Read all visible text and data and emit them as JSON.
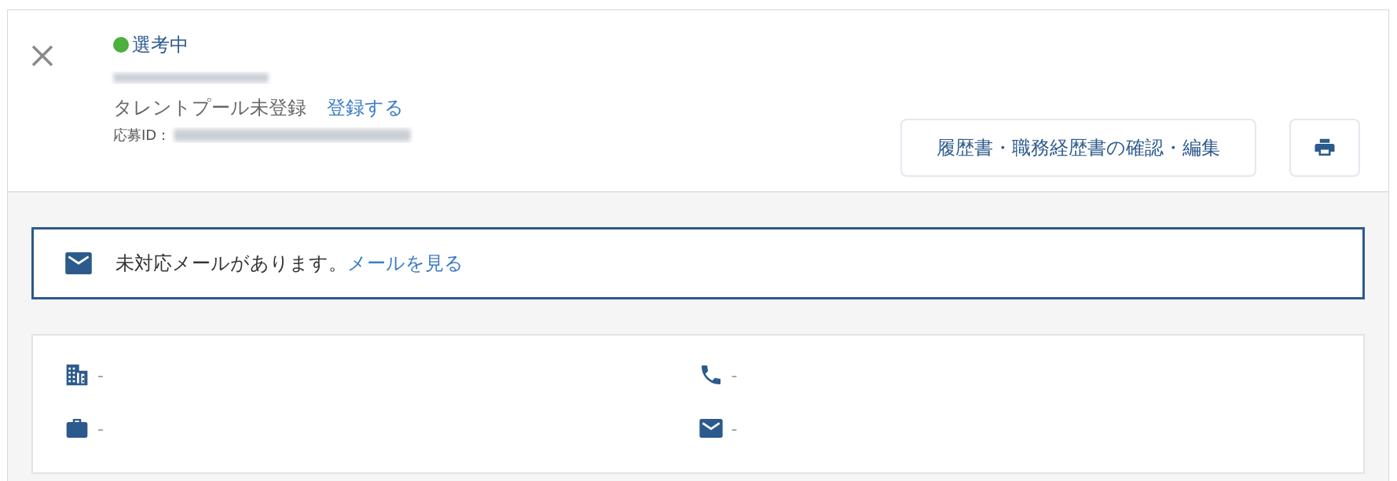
{
  "status": {
    "label": "選考中",
    "color": "#4caf3e"
  },
  "talent_pool": {
    "label": "タレントプール未登録",
    "link": "登録する"
  },
  "application_id": {
    "label": "応募ID："
  },
  "resume_button": {
    "label": "履歴書・職務経歴書の確認・編集"
  },
  "notice": {
    "text": "未対応メールがあります。",
    "link": "メールを見る"
  },
  "info_fields": [
    {
      "kind": "company",
      "value": "-"
    },
    {
      "kind": "phone",
      "value": "-"
    },
    {
      "kind": "job",
      "value": "-"
    },
    {
      "kind": "mail",
      "value": "-"
    }
  ]
}
